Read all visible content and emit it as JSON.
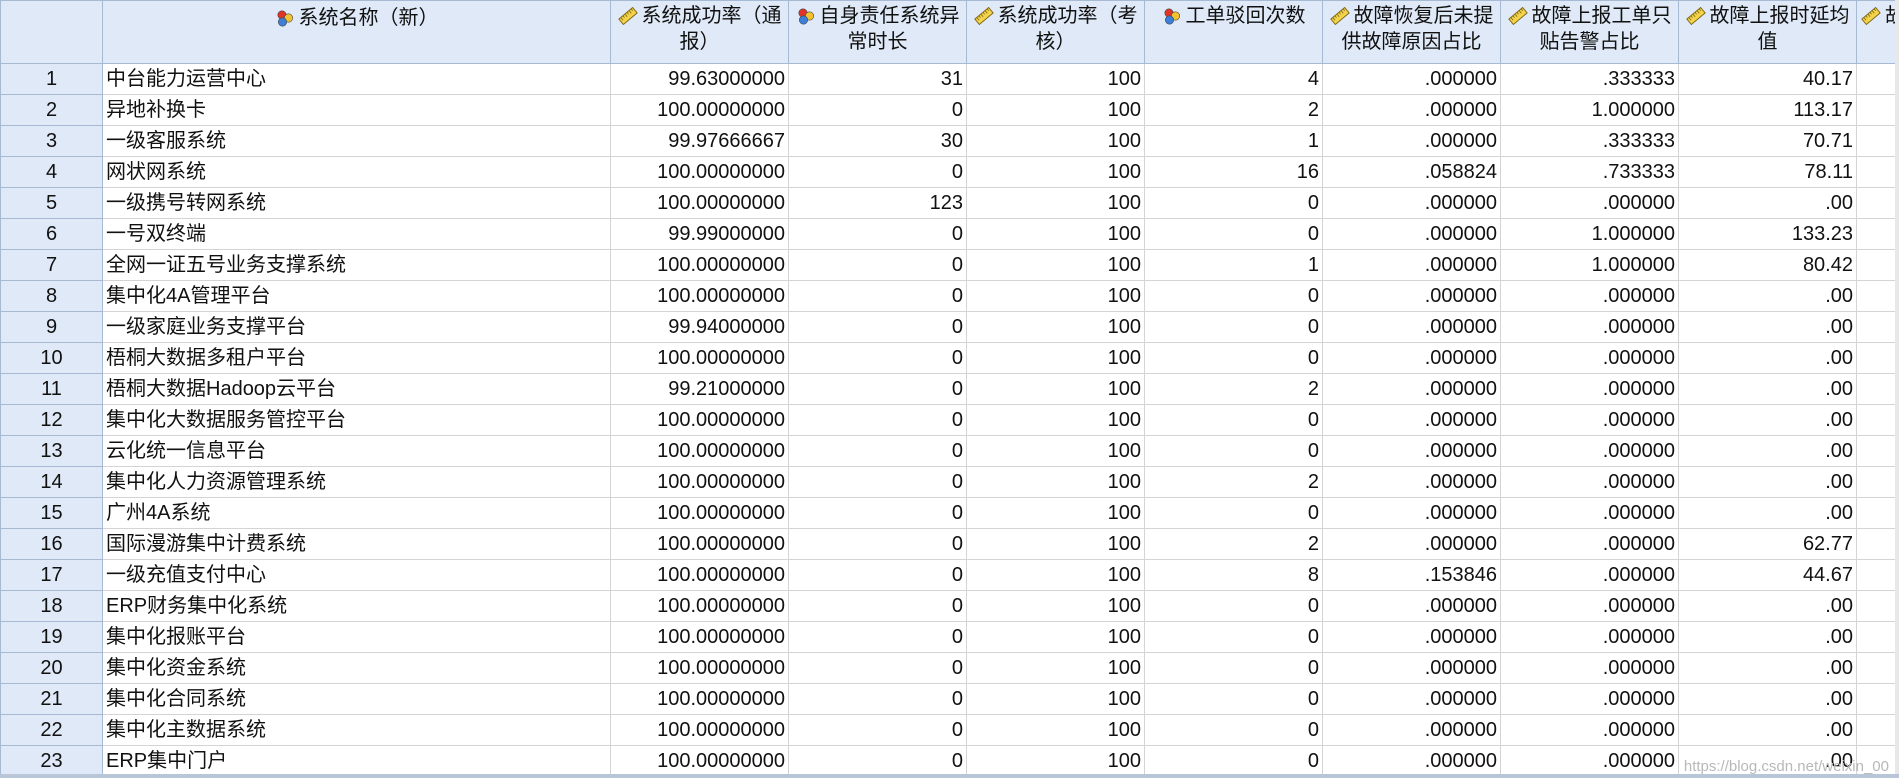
{
  "grid": {
    "columns": [
      {
        "label": "系统名称（新）",
        "icon": "nominal-variable-icon"
      },
      {
        "label": "系统成功率（通报）",
        "icon": "scale-variable-icon"
      },
      {
        "label": "自身责任系统异常时长",
        "icon": "nominal-variable-icon"
      },
      {
        "label": "系统成功率（考核）",
        "icon": "scale-variable-icon"
      },
      {
        "label": "工单驳回次数",
        "icon": "nominal-variable-icon"
      },
      {
        "label": "故障恢复后未提供故障原因占比",
        "icon": "scale-variable-icon"
      },
      {
        "label": "故障上报工单只贴告警占比",
        "icon": "scale-variable-icon"
      },
      {
        "label": "故障上报时延均值",
        "icon": "scale-variable-icon"
      },
      {
        "label": "故",
        "icon": "scale-variable-icon"
      }
    ],
    "rows": [
      {
        "n": "1",
        "name": "中台能力运营中心",
        "v": [
          "99.63000000",
          "31",
          "100",
          "4",
          ".000000",
          ".333333",
          "40.17"
        ]
      },
      {
        "n": "2",
        "name": "异地补换卡",
        "v": [
          "100.00000000",
          "0",
          "100",
          "2",
          ".000000",
          "1.000000",
          "113.17"
        ]
      },
      {
        "n": "3",
        "name": "一级客服系统",
        "v": [
          "99.97666667",
          "30",
          "100",
          "1",
          ".000000",
          ".333333",
          "70.71"
        ]
      },
      {
        "n": "4",
        "name": "网状网系统",
        "v": [
          "100.00000000",
          "0",
          "100",
          "16",
          ".058824",
          ".733333",
          "78.11"
        ]
      },
      {
        "n": "5",
        "name": "一级携号转网系统",
        "v": [
          "100.00000000",
          "123",
          "100",
          "0",
          ".000000",
          ".000000",
          ".00"
        ]
      },
      {
        "n": "6",
        "name": "一号双终端",
        "v": [
          "99.99000000",
          "0",
          "100",
          "0",
          ".000000",
          "1.000000",
          "133.23"
        ]
      },
      {
        "n": "7",
        "name": "全网一证五号业务支撑系统",
        "v": [
          "100.00000000",
          "0",
          "100",
          "1",
          ".000000",
          "1.000000",
          "80.42"
        ]
      },
      {
        "n": "8",
        "name": "集中化4A管理平台",
        "v": [
          "100.00000000",
          "0",
          "100",
          "0",
          ".000000",
          ".000000",
          ".00"
        ]
      },
      {
        "n": "9",
        "name": "一级家庭业务支撑平台",
        "v": [
          "99.94000000",
          "0",
          "100",
          "0",
          ".000000",
          ".000000",
          ".00"
        ]
      },
      {
        "n": "10",
        "name": "梧桐大数据多租户平台",
        "v": [
          "100.00000000",
          "0",
          "100",
          "0",
          ".000000",
          ".000000",
          ".00"
        ]
      },
      {
        "n": "11",
        "name": "梧桐大数据Hadoop云平台",
        "v": [
          "99.21000000",
          "0",
          "100",
          "2",
          ".000000",
          ".000000",
          ".00"
        ]
      },
      {
        "n": "12",
        "name": "集中化大数据服务管控平台",
        "v": [
          "100.00000000",
          "0",
          "100",
          "0",
          ".000000",
          ".000000",
          ".00"
        ]
      },
      {
        "n": "13",
        "name": "云化统一信息平台",
        "v": [
          "100.00000000",
          "0",
          "100",
          "0",
          ".000000",
          ".000000",
          ".00"
        ]
      },
      {
        "n": "14",
        "name": "集中化人力资源管理系统",
        "v": [
          "100.00000000",
          "0",
          "100",
          "2",
          ".000000",
          ".000000",
          ".00"
        ]
      },
      {
        "n": "15",
        "name": "广州4A系统",
        "v": [
          "100.00000000",
          "0",
          "100",
          "0",
          ".000000",
          ".000000",
          ".00"
        ]
      },
      {
        "n": "16",
        "name": "国际漫游集中计费系统",
        "v": [
          "100.00000000",
          "0",
          "100",
          "2",
          ".000000",
          ".000000",
          "62.77"
        ]
      },
      {
        "n": "17",
        "name": "一级充值支付中心",
        "v": [
          "100.00000000",
          "0",
          "100",
          "8",
          ".153846",
          ".000000",
          "44.67"
        ]
      },
      {
        "n": "18",
        "name": "ERP财务集中化系统",
        "v": [
          "100.00000000",
          "0",
          "100",
          "0",
          ".000000",
          ".000000",
          ".00"
        ]
      },
      {
        "n": "19",
        "name": "集中化报账平台",
        "v": [
          "100.00000000",
          "0",
          "100",
          "0",
          ".000000",
          ".000000",
          ".00"
        ]
      },
      {
        "n": "20",
        "name": "集中化资金系统",
        "v": [
          "100.00000000",
          "0",
          "100",
          "0",
          ".000000",
          ".000000",
          ".00"
        ]
      },
      {
        "n": "21",
        "name": "集中化合同系统",
        "v": [
          "100.00000000",
          "0",
          "100",
          "0",
          ".000000",
          ".000000",
          ".00"
        ]
      },
      {
        "n": "22",
        "name": "集中化主数据系统",
        "v": [
          "100.00000000",
          "0",
          "100",
          "0",
          ".000000",
          ".000000",
          ".00"
        ]
      },
      {
        "n": "23",
        "name": "ERP集中门户",
        "v": [
          "100.00000000",
          "0",
          "100",
          "0",
          ".000000",
          ".000000",
          ".00"
        ]
      }
    ]
  },
  "watermark": "https://blog.csdn.net/weixin_00",
  "colors": {
    "header_bg": "#dfe9f7",
    "header_border": "#a7bad3",
    "cell_border": "#d4d4d4"
  }
}
